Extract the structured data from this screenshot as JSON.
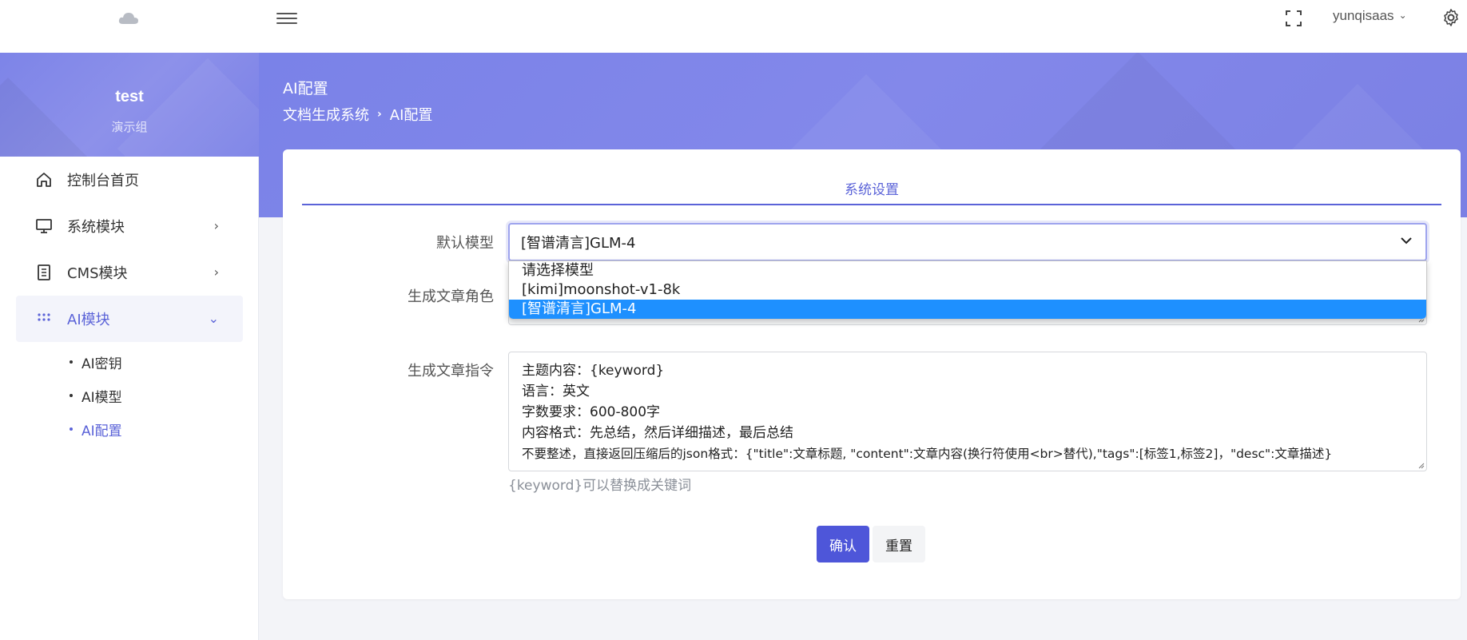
{
  "header": {
    "user_name": "yunqisaas"
  },
  "sidebar": {
    "org_name": "test",
    "org_group": "演示组",
    "items": [
      {
        "label": "控制台首页"
      },
      {
        "label": "系统模块"
      },
      {
        "label": "CMS模块"
      },
      {
        "label": "AI模块"
      }
    ],
    "submenu": [
      {
        "label": "AI密钥"
      },
      {
        "label": "AI模型"
      },
      {
        "label": "AI配置"
      }
    ]
  },
  "page": {
    "title": "AI配置",
    "breadcrumb": [
      "文档生成系统",
      "AI配置"
    ]
  },
  "form": {
    "tab_label": "系统设置",
    "default_model_label": "默认模型",
    "default_model_value": "[智谱清言]GLM-4",
    "model_options": [
      "请选择模型",
      "[kimi]moonshot-v1-8k",
      "[智谱清言]GLM-4"
    ],
    "role_label": "生成文章角色",
    "command_label": "生成文章指令",
    "command_lines": [
      "主题内容：{keyword}",
      "语言：英文",
      "字数要求：600-800字",
      "内容格式：先总结，然后详细描述，最后总结",
      "不要整述，直接返回压缩后的json格式：{\"title\":文章标题, \"content\":文章内容(换行符使用<br>替代),\"tags\":[标签1,标签2]，\"desc\":文章描述}"
    ],
    "hint": "{keyword}可以替换成关键词",
    "confirm_label": "确认",
    "reset_label": "重置"
  },
  "colors": {
    "accent": "#5b63d8",
    "banner": "#7d84e8",
    "selected_option": "#1e90ff"
  }
}
